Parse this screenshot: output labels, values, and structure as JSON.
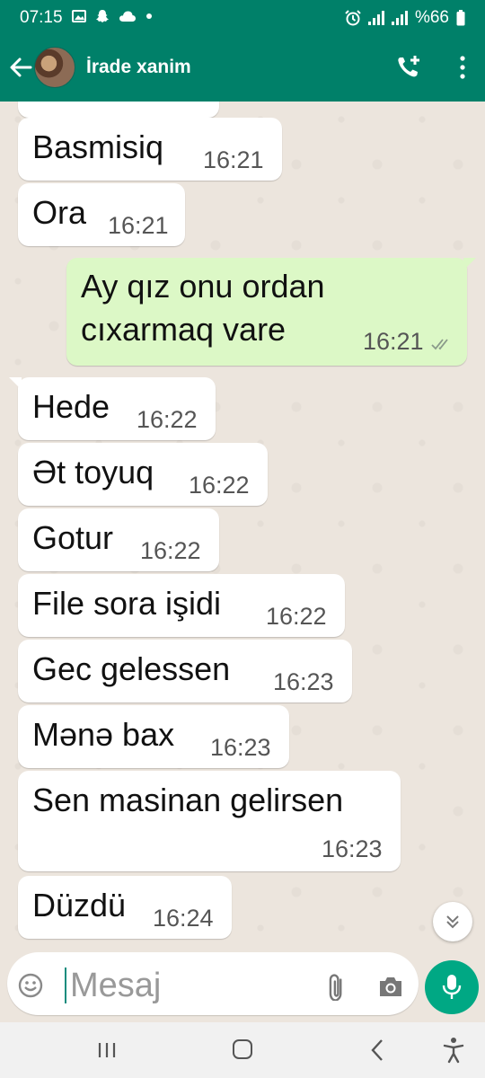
{
  "status": {
    "time": "07:15",
    "battery": "%66",
    "left_icons": [
      "gallery-icon",
      "snapchat-icon",
      "cloud-icon",
      "dot-icon"
    ],
    "right_icons": [
      "alarm-icon",
      "signal-icon",
      "signal-icon",
      "battery-icon"
    ]
  },
  "header": {
    "contact_name": "İrade xanim",
    "icons": [
      "back-arrow-icon",
      "avatar",
      "add-call-icon",
      "more-vert-icon"
    ]
  },
  "messages": [
    {
      "direction": "in",
      "text": "Basmisiq",
      "time": "16:21"
    },
    {
      "direction": "in",
      "text": "Ora",
      "time": "16:21"
    },
    {
      "direction": "out",
      "lines": [
        "Ay qız onu ordan",
        "cıxarmaq vare"
      ],
      "time": "16:21",
      "status": "read"
    },
    {
      "direction": "in",
      "text": "Hede",
      "time": "16:22"
    },
    {
      "direction": "in",
      "text": "Ət toyuq",
      "time": "16:22"
    },
    {
      "direction": "in",
      "text": "Gotur",
      "time": "16:22"
    },
    {
      "direction": "in",
      "text": "File sora işidi",
      "time": "16:22"
    },
    {
      "direction": "in",
      "text": "Gec gelessen",
      "time": "16:23"
    },
    {
      "direction": "in",
      "text": "Mənə bax",
      "time": "16:23"
    },
    {
      "direction": "in",
      "text": "Sen masinan gelirsen",
      "time": "16:23"
    },
    {
      "direction": "in",
      "text": "Düzdü",
      "time": "16:24"
    }
  ],
  "composer": {
    "placeholder": "Mesaj",
    "icons": [
      "emoji-icon",
      "attach-icon",
      "camera-icon",
      "mic-icon"
    ]
  },
  "colors": {
    "header": "#008069",
    "outgoing_bubble": "#dcf8c6",
    "incoming_bubble": "#ffffff",
    "chat_background": "#ece5dd",
    "mic_button": "#00a884"
  }
}
